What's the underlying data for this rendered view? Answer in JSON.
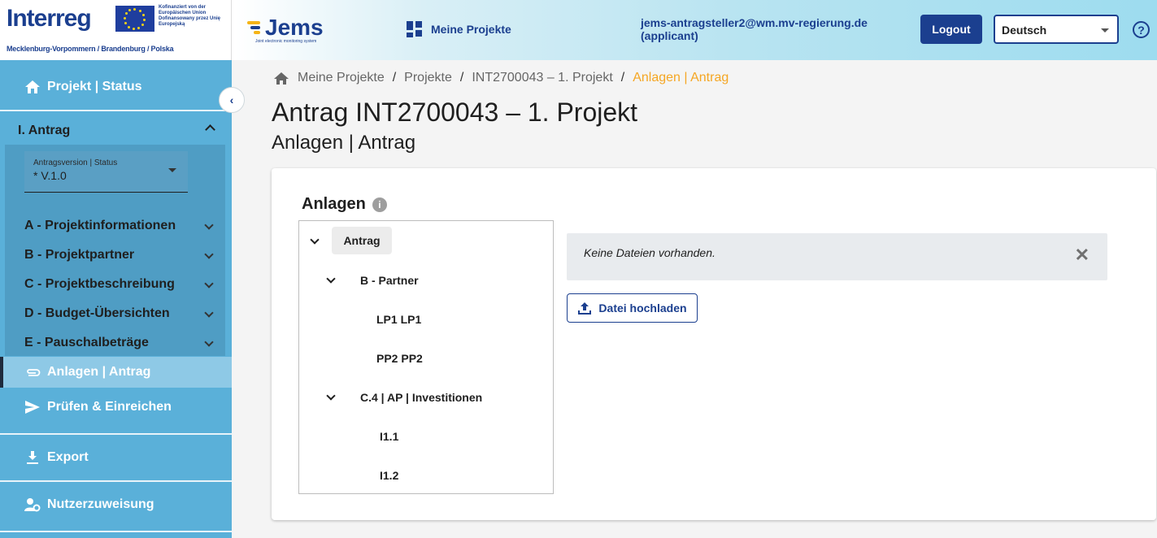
{
  "header": {
    "brand_logo": "Interreg",
    "eu_text": "Kofinanziert von der Europäischen Union Dofinansowany przez Unię Europejską",
    "region": "Mecklenburg-Vorpommern / Brandenburg / Polska",
    "app_logo": "Jems",
    "app_logo_sub": "Joint electronic monitoring system",
    "nav_label": "Meine Projekte",
    "user_email": "jems-antragsteller2@wm.mv-regierung.de",
    "user_role": "(applicant)",
    "logout_label": "Logout",
    "language": "Deutsch",
    "help_icon": "?"
  },
  "sidebar": {
    "projekt_status": "Projekt | Status",
    "antrag_section": "I. Antrag",
    "version_label": "Antragsversion | Status",
    "version_value": "* V.1.0",
    "sections": [
      {
        "label": "A - Projektinformationen"
      },
      {
        "label": "B - Projektpartner"
      },
      {
        "label": "C - Projektbeschreibung"
      },
      {
        "label": "D - Budget-Übersichten"
      },
      {
        "label": "E - Pauschalbeträge"
      }
    ],
    "anlagen": "Anlagen | Antrag",
    "pruefen": "Prüfen & Einreichen",
    "export": "Export",
    "nutzerzuweisung": "Nutzerzuweisung",
    "collapse_icon": "‹"
  },
  "breadcrumb": {
    "items": [
      "Meine Projekte",
      "Projekte",
      "INT2700043 – 1. Projekt"
    ],
    "separator": "/",
    "current": "Anlagen | Antrag"
  },
  "main": {
    "title": "Antrag INT2700043 – 1. Projekt",
    "subtitle": "Anlagen | Antrag",
    "card_title": "Anlagen",
    "info_icon": "i",
    "tree": {
      "root": "Antrag",
      "partner_group": "B - Partner",
      "partners": [
        "LP1 LP1",
        "PP2 PP2"
      ],
      "invest_group": "C.4 | AP | Investitionen",
      "investments": [
        "I1.1",
        "I1.2"
      ]
    },
    "empty_message": "Keine Dateien vorhanden.",
    "close_icon": "✕",
    "upload_label": "Datei hochladen"
  },
  "colors": {
    "primary": "#1b3f8f",
    "sidebar": "#5ab0d9",
    "sidebar_active": "#8ec9e6",
    "breadcrumb_current": "#f5a623"
  }
}
